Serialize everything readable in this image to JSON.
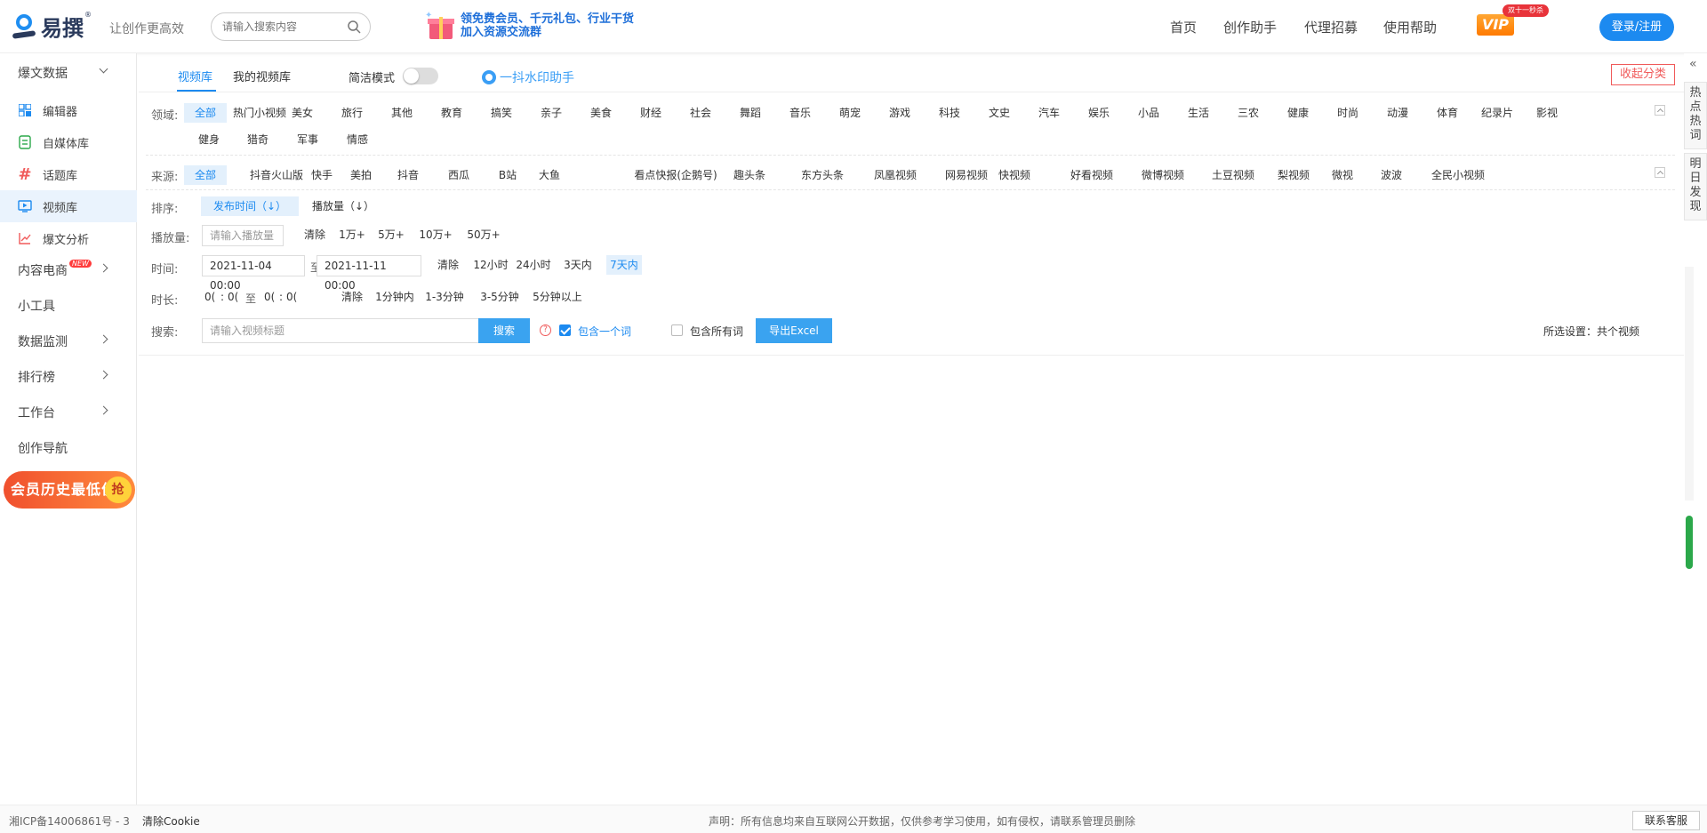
{
  "header": {
    "brand": "易撰",
    "slogan": "让创作更高效",
    "search_placeholder": "请输入搜索内容",
    "banner_line1": "领免费会员、千元礼包、行业干货",
    "banner_line2": "加入资源交流群",
    "nav": [
      "首页",
      "创作助手",
      "代理招募",
      "使用帮助"
    ],
    "vip_label": "VIP",
    "vip_badge": "双十一秒杀",
    "login_label": "登录/注册"
  },
  "sidebar": {
    "section_baowen": "爆文数据",
    "sub_items": [
      "编辑器",
      "自媒体库",
      "话题库",
      "视频库",
      "爆文分析"
    ],
    "active_item": "视频库",
    "section_ecom": "内容电商",
    "new_badge": "NEW",
    "tools": "小工具",
    "monitor": "数据监测",
    "ranking": "排行榜",
    "workbench": "工作台",
    "guide": "创作导航",
    "promo_text": "会员历史最低价",
    "promo_badge": "抢"
  },
  "tabs": {
    "video_lib": "视频库",
    "my_video_lib": "我的视频库",
    "simple_mode": "简洁模式",
    "watermark": "一抖水印助手",
    "collapse": "收起分类"
  },
  "filters": {
    "domain_label": "领域:",
    "domain_row1": [
      "全部",
      "热门小视频",
      "美女",
      "旅行",
      "其他",
      "教育",
      "搞笑",
      "亲子",
      "美食",
      "财经",
      "社会",
      "舞蹈",
      "音乐",
      "萌宠",
      "游戏",
      "科技",
      "文史",
      "汽车",
      "娱乐",
      "小品",
      "生活",
      "三农",
      "健康",
      "时尚",
      "动漫",
      "体育",
      "纪录片",
      "影视"
    ],
    "domain_row2": [
      "健身",
      "猎奇",
      "军事",
      "情感"
    ],
    "source_label": "来源:",
    "sources": [
      "全部",
      "抖音火山版",
      "快手",
      "美拍",
      "抖音",
      "西瓜",
      "B站",
      "大鱼",
      "看点快报(企鹅号)",
      "趣头条",
      "东方头条",
      "凤凰视频",
      "网易视频",
      "快视频",
      "好看视频",
      "微博视频",
      "土豆视频",
      "梨视频",
      "微视",
      "波波",
      "全民小视频"
    ],
    "sort_label": "排序:",
    "sort_publish": "发布时间（↓）",
    "sort_plays": "播放量（↓）",
    "plays_label": "播放量:",
    "plays_placeholder": "请输入播放量",
    "plays_options": [
      "清除",
      "1万+",
      "5万+",
      "10万+",
      "50万+"
    ],
    "time_label": "时间:",
    "time_start": "2021-11-04 00:00",
    "time_to": "至",
    "time_end": "2021-11-11 00:00",
    "time_options": [
      "清除",
      "12小时",
      "24小时",
      "3天内",
      "7天内"
    ],
    "duration_label": "时长:",
    "dur_h1": "0(",
    "dur_m1": "0(",
    "dur_sep": ":",
    "dur_to": "至",
    "dur_h2": "0(",
    "dur_m2": "0(",
    "duration_options": [
      "清除",
      "1分钟内",
      "1-3分钟",
      "3-5分钟",
      "5分钟以上"
    ],
    "search_label": "搜索:",
    "search_placeholder": "请输入视频标题",
    "search_btn": "搜索",
    "help_q": "?",
    "contains_one": "包含一个词",
    "contains_all": "包含所有词",
    "export_btn": "导出Excel",
    "selected_setting": "所选设置：共个视频"
  },
  "rightbar": {
    "arrow": "«",
    "hot_words": "热点热词",
    "tomorrow": "明日发现"
  },
  "footer": {
    "icp": "湘ICP备14006861号 - 3",
    "clear_cookie": "清除Cookie",
    "disclaimer": "声明：所有信息均来自互联网公开数据，仅供参考学习使用，如有侵权，请联系管理员删除",
    "contact": "联系客服"
  },
  "colors": {
    "accent": "#1c8af0",
    "selected_bg": "#e3f0fc",
    "danger": "#f05a5a"
  }
}
